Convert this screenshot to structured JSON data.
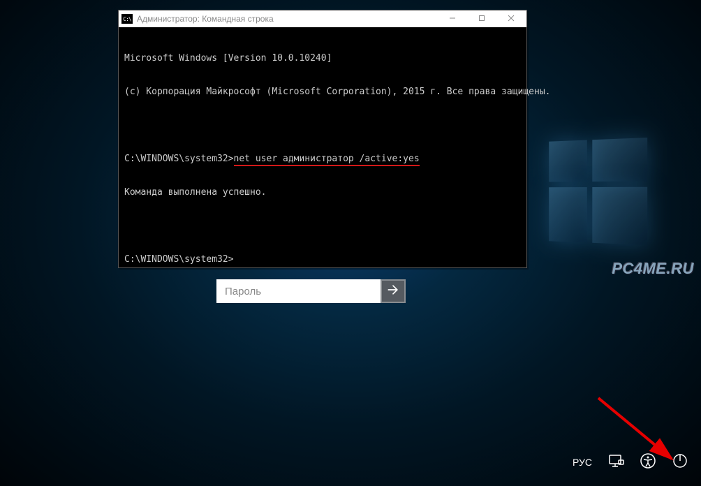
{
  "logo_panes": 4,
  "watermark": "PC4ME.RU",
  "password": {
    "placeholder": "Пароль",
    "value": ""
  },
  "cmd": {
    "title": "Администратор: Командная строка",
    "line1": "Microsoft Windows [Version 10.0.10240]",
    "line2": "(c) Корпорация Майкрософт (Microsoft Corporation), 2015 г. Все права защищены.",
    "prompt1_prefix": "C:\\WINDOWS\\system32>",
    "command": "net user администратор /active:yes",
    "result": "Команда выполнена успешно.",
    "prompt2": "C:\\WINDOWS\\system32>"
  },
  "corner": {
    "lang": "РУС"
  }
}
